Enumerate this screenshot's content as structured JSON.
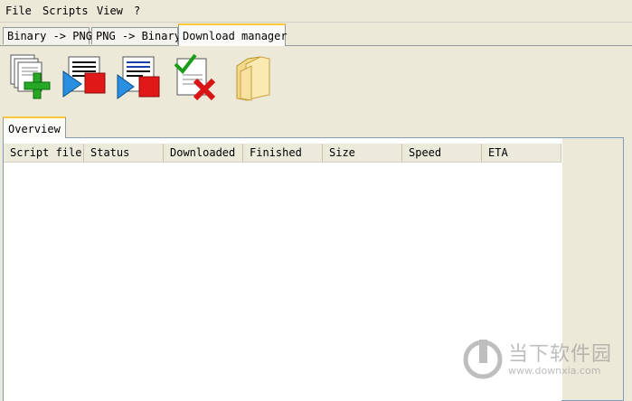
{
  "menu": {
    "items": [
      "File",
      "Scripts",
      "View",
      "?"
    ]
  },
  "tabs": [
    {
      "label": "Binary -> PNG",
      "active": false
    },
    {
      "label": "PNG -> Binary",
      "active": false
    },
    {
      "label": "Download manager",
      "active": true
    }
  ],
  "toolbar": {
    "buttons": [
      {
        "icon": "add-documents-icon"
      },
      {
        "icon": "start-selected-icon"
      },
      {
        "icon": "start-all-icon"
      },
      {
        "icon": "remove-finished-icon"
      },
      {
        "icon": "open-folder-icon"
      }
    ]
  },
  "subtab": {
    "label": "Overview"
  },
  "list": {
    "columns": [
      "Script file",
      "Status",
      "Downloaded",
      "Finished",
      "Size",
      "Speed",
      "ETA"
    ],
    "rows": []
  },
  "watermark": {
    "title": "当下软件园",
    "url": "www.downxia.com"
  },
  "colors": {
    "window_bg": "#ece9d8",
    "tab_highlight": "#ffc83c",
    "list_border": "#7f9db9"
  }
}
